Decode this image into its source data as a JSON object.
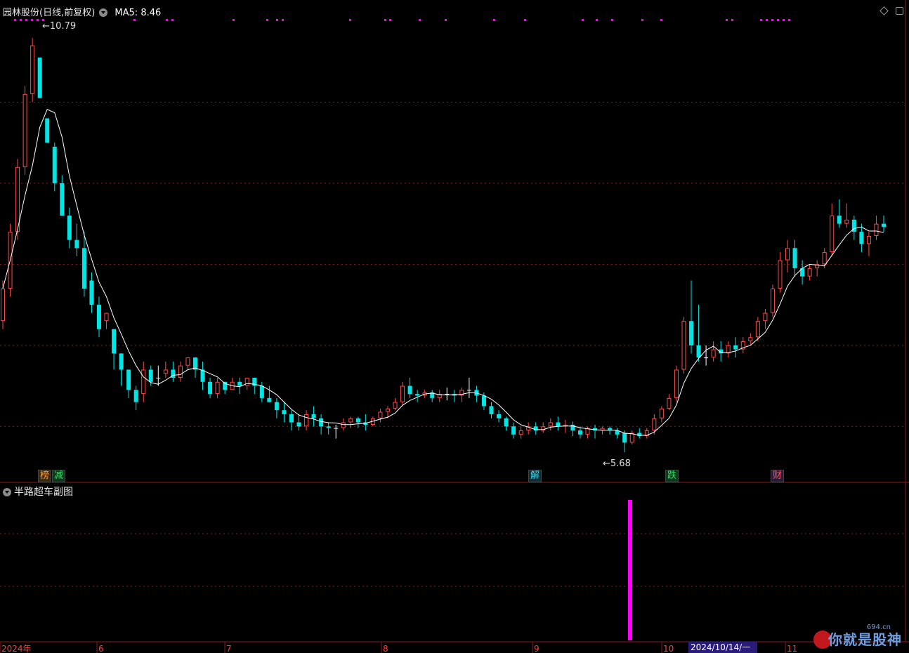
{
  "header": {
    "stock_title": "园林股份(日线,前复权)",
    "ma_label": "MA5: 8.46"
  },
  "sub_panel": {
    "title": "半路超车副图"
  },
  "annotations": {
    "high_label": "10.79",
    "low_label": "5.68"
  },
  "badges": [
    {
      "text": "榜",
      "color": "#ff9a3c",
      "bg": "#3a2a10"
    },
    {
      "text": "减",
      "color": "#3cd46a",
      "bg": "#0e3a1c"
    },
    {
      "text": "解",
      "color": "#4ad0e0",
      "bg": "#0e2e3a"
    },
    {
      "text": "跌",
      "color": "#3cd46a",
      "bg": "#0e3a1c"
    },
    {
      "text": "财",
      "color": "#ff5a5a",
      "bg": "#2a1a3a"
    }
  ],
  "x_axis": {
    "labels": [
      "2024年",
      "6",
      "7",
      "8",
      "9",
      "10",
      "11"
    ],
    "cursor_date": "2024/10/14/一"
  },
  "watermark": {
    "text": "你就是股神",
    "url": "694.cn"
  },
  "colors": {
    "up": "#ff4a4a",
    "down": "#00e6e6",
    "doji": "#ffffff",
    "ma": "#ffffff",
    "grid": "#8a1a1a",
    "signal": "#ff00ff"
  },
  "chart_data": {
    "type": "candlestick",
    "title": "园林股份(日线,前复权)",
    "ma_period": 5,
    "y_range": [
      5.5,
      11.0
    ],
    "candles": [
      [
        7.3,
        7.8,
        7.7,
        7.2
      ],
      [
        7.7,
        8.5,
        8.4,
        7.6
      ],
      [
        8.4,
        9.3,
        9.2,
        8.3
      ],
      [
        9.2,
        10.2,
        10.1,
        9.1
      ],
      [
        10.1,
        10.79,
        10.7,
        10.0
      ],
      [
        10.55,
        10.55,
        10.05,
        10.05
      ],
      [
        9.8,
        9.7,
        9.5,
        9.8
      ],
      [
        9.45,
        9.5,
        9.0,
        8.9
      ],
      [
        9.0,
        9.1,
        8.6,
        8.6
      ],
      [
        8.6,
        8.7,
        8.3,
        8.2
      ],
      [
        8.3,
        8.5,
        8.2,
        8.1
      ],
      [
        8.2,
        8.4,
        7.7,
        7.6
      ],
      [
        7.8,
        7.9,
        7.5,
        7.4
      ],
      [
        7.5,
        7.6,
        7.2,
        7.1
      ],
      [
        7.3,
        7.4,
        7.4,
        7.2
      ],
      [
        7.2,
        7.2,
        6.9,
        6.7
      ],
      [
        6.9,
        6.9,
        6.7,
        6.5
      ],
      [
        6.7,
        6.7,
        6.45,
        6.35
      ],
      [
        6.45,
        6.5,
        6.3,
        6.2
      ],
      [
        6.4,
        6.8,
        6.7,
        6.3
      ],
      [
        6.7,
        6.75,
        6.55,
        6.5
      ],
      [
        6.6,
        6.75,
        6.6,
        6.5
      ],
      [
        6.65,
        6.8,
        6.7,
        6.6
      ],
      [
        6.7,
        6.8,
        6.6,
        6.55
      ],
      [
        6.6,
        6.8,
        6.75,
        6.55
      ],
      [
        6.75,
        6.85,
        6.85,
        6.7
      ],
      [
        6.85,
        6.85,
        6.7,
        6.6
      ],
      [
        6.7,
        6.8,
        6.55,
        6.45
      ],
      [
        6.55,
        6.6,
        6.4,
        6.35
      ],
      [
        6.4,
        6.6,
        6.55,
        6.35
      ],
      [
        6.55,
        6.55,
        6.45,
        6.4
      ],
      [
        6.45,
        6.6,
        6.55,
        6.45
      ],
      [
        6.55,
        6.6,
        6.5,
        6.4
      ],
      [
        6.5,
        6.6,
        6.6,
        6.45
      ],
      [
        6.6,
        6.6,
        6.5,
        6.4
      ],
      [
        6.5,
        6.55,
        6.35,
        6.3
      ],
      [
        6.35,
        6.5,
        6.3,
        6.3
      ],
      [
        6.3,
        6.35,
        6.2,
        6.1
      ],
      [
        6.2,
        6.3,
        6.15,
        6.05
      ],
      [
        6.15,
        6.2,
        6.05,
        5.95
      ],
      [
        6.05,
        6.15,
        6.0,
        5.95
      ],
      [
        6.0,
        6.2,
        6.15,
        5.95
      ],
      [
        6.15,
        6.25,
        6.1,
        6.0
      ],
      [
        6.1,
        6.15,
        6.0,
        5.9
      ],
      [
        6.0,
        6.05,
        5.98,
        5.9
      ],
      [
        5.98,
        6.02,
        5.98,
        5.85
      ],
      [
        5.98,
        6.1,
        6.05,
        5.95
      ],
      [
        6.05,
        6.12,
        6.1,
        5.98
      ],
      [
        6.1,
        6.12,
        6.05,
        5.98
      ],
      [
        6.05,
        6.15,
        6.02,
        5.95
      ],
      [
        6.02,
        6.12,
        6.1,
        6.0
      ],
      [
        6.1,
        6.22,
        6.18,
        6.05
      ],
      [
        6.18,
        6.25,
        6.22,
        6.1
      ],
      [
        6.22,
        6.35,
        6.3,
        6.2
      ],
      [
        6.3,
        6.55,
        6.5,
        6.25
      ],
      [
        6.5,
        6.6,
        6.4,
        6.35
      ],
      [
        6.4,
        6.45,
        6.38,
        6.3
      ],
      [
        6.38,
        6.45,
        6.42,
        6.35
      ],
      [
        6.42,
        6.45,
        6.35,
        6.3
      ],
      [
        6.35,
        6.45,
        6.4,
        6.3
      ],
      [
        6.4,
        6.48,
        6.4,
        6.32
      ],
      [
        6.4,
        6.45,
        6.38,
        6.3
      ],
      [
        6.38,
        6.48,
        6.45,
        6.3
      ],
      [
        6.45,
        6.6,
        6.45,
        6.35
      ],
      [
        6.45,
        6.5,
        6.38,
        6.3
      ],
      [
        6.38,
        6.42,
        6.25,
        6.2
      ],
      [
        6.25,
        6.3,
        6.15,
        6.1
      ],
      [
        6.15,
        6.2,
        6.1,
        6.05
      ],
      [
        6.1,
        6.12,
        6.0,
        5.95
      ],
      [
        6.0,
        6.05,
        5.9,
        5.85
      ],
      [
        5.9,
        6.0,
        5.95,
        5.85
      ],
      [
        5.95,
        6.05,
        6.0,
        5.9
      ],
      [
        6.0,
        6.05,
        5.95,
        5.9
      ],
      [
        5.95,
        6.05,
        6.0,
        5.92
      ],
      [
        6.0,
        6.1,
        6.05,
        5.95
      ],
      [
        6.05,
        6.12,
        6.0,
        5.95
      ],
      [
        6.0,
        6.08,
        6.02,
        5.92
      ],
      [
        6.02,
        6.06,
        5.95,
        5.88
      ],
      [
        5.95,
        6.0,
        5.9,
        5.85
      ],
      [
        5.9,
        6.0,
        5.98,
        5.85
      ],
      [
        5.98,
        6.02,
        5.95,
        5.85
      ],
      [
        5.95,
        6.0,
        5.98,
        5.9
      ],
      [
        5.98,
        6.0,
        5.95,
        5.9
      ],
      [
        5.95,
        5.98,
        5.9,
        5.85
      ],
      [
        5.92,
        5.95,
        5.8,
        5.68
      ],
      [
        5.8,
        5.95,
        5.92,
        5.78
      ],
      [
        5.92,
        5.98,
        5.88,
        5.85
      ],
      [
        5.88,
        5.98,
        5.95,
        5.85
      ],
      [
        5.95,
        6.15,
        6.1,
        5.9
      ],
      [
        6.1,
        6.25,
        6.22,
        6.05
      ],
      [
        6.22,
        6.4,
        6.35,
        6.2
      ],
      [
        6.35,
        6.75,
        6.7,
        6.3
      ],
      [
        6.7,
        7.35,
        7.3,
        6.65
      ],
      [
        7.3,
        7.8,
        7.0,
        6.9
      ],
      [
        7.0,
        7.5,
        6.85,
        6.8
      ],
      [
        6.85,
        7.0,
        6.85,
        6.75
      ],
      [
        6.85,
        7.05,
        6.95,
        6.8
      ],
      [
        6.95,
        7.05,
        6.9,
        6.8
      ],
      [
        6.9,
        7.05,
        7.0,
        6.85
      ],
      [
        7.0,
        7.1,
        6.95,
        6.85
      ],
      [
        6.95,
        7.1,
        7.05,
        6.9
      ],
      [
        7.05,
        7.15,
        7.1,
        7.0
      ],
      [
        7.1,
        7.35,
        7.3,
        7.05
      ],
      [
        7.3,
        7.45,
        7.4,
        7.2
      ],
      [
        7.4,
        7.75,
        7.7,
        7.35
      ],
      [
        7.7,
        8.15,
        8.05,
        7.65
      ],
      [
        8.05,
        8.3,
        8.2,
        7.9
      ],
      [
        8.2,
        8.3,
        7.95,
        7.85
      ],
      [
        7.95,
        8.05,
        7.85,
        7.75
      ],
      [
        7.85,
        8.0,
        7.95,
        7.8
      ],
      [
        7.95,
        8.05,
        8.0,
        7.85
      ],
      [
        8.0,
        8.2,
        8.15,
        7.95
      ],
      [
        8.15,
        8.75,
        8.6,
        8.1
      ],
      [
        8.6,
        8.8,
        8.5,
        8.45
      ],
      [
        8.5,
        8.75,
        8.55,
        8.45
      ],
      [
        8.55,
        8.6,
        8.4,
        8.3
      ],
      [
        8.4,
        8.5,
        8.25,
        8.15
      ],
      [
        8.25,
        8.4,
        8.35,
        8.1
      ],
      [
        8.35,
        8.6,
        8.5,
        8.3
      ],
      [
        8.5,
        8.6,
        8.46,
        8.4
      ]
    ],
    "sub_signal": [
      {
        "index": 89,
        "value": 1
      }
    ]
  }
}
